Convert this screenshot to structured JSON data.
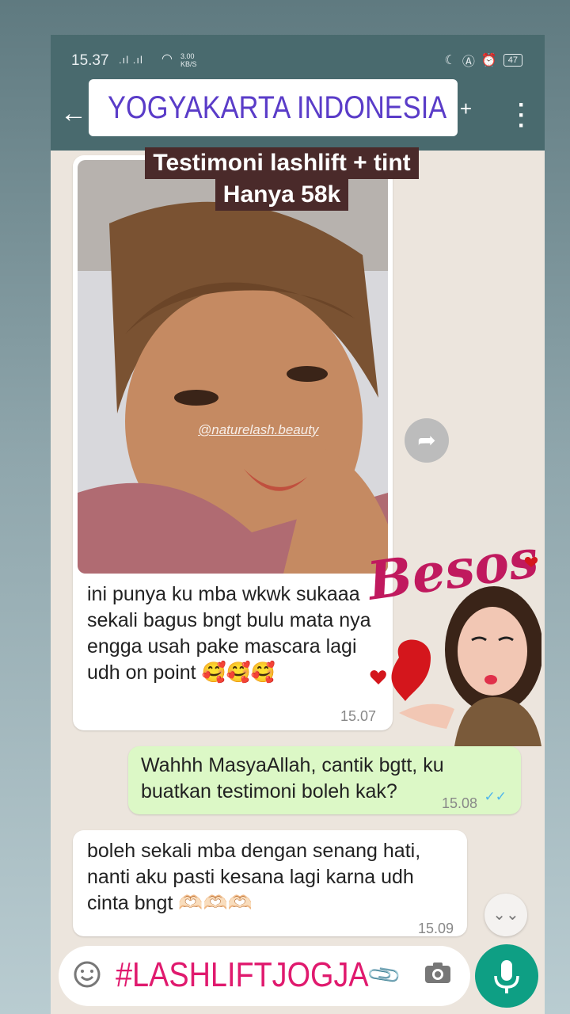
{
  "status_bar": {
    "time": "15.37",
    "signal": ".ıl .ıl",
    "speed_value": "3.00",
    "speed_unit": "KB/S",
    "battery": "47"
  },
  "app_bar": {
    "back_icon": "arrow-back-icon",
    "menu_icon": "more-vert-icon"
  },
  "overlay": {
    "location": "YOGYAKARTA INDONESIA",
    "headline_line1": "Testimoni lashlift + tint",
    "headline_line2": "Hanya 58k",
    "watermark": "@naturelash.beauty",
    "sticker_text": "Besos"
  },
  "messages": [
    {
      "direction": "incoming",
      "has_image": true,
      "text": "ini punya ku mba wkwk sukaaa sekali bagus bngt bulu mata nya engga usah pake mascara lagi udh on point 🥰🥰🥰",
      "time": "15.07"
    },
    {
      "direction": "outgoing",
      "text": "Wahhh MasyaAllah, cantik bgtt, ku buatkan testimoni boleh kak?",
      "time": "15.08",
      "ticks": "✓✓"
    },
    {
      "direction": "incoming",
      "text": "boleh sekali mba dengan senang hati, nanti aku pasti kesana lagi karna udh cinta bngt 🫶🏻🫶🏻🫶🏻",
      "time": "15.09"
    }
  ],
  "input_bar": {
    "text": "#LASHLIFTJOGJA"
  },
  "colors": {
    "header": "#496a6e",
    "chat_background": "#ece5dd",
    "outgoing_bubble": "#dcf8c6",
    "mic_button": "#0e9f84",
    "location_text": "#5a3cc8",
    "hashtag": "#e01a6e"
  }
}
